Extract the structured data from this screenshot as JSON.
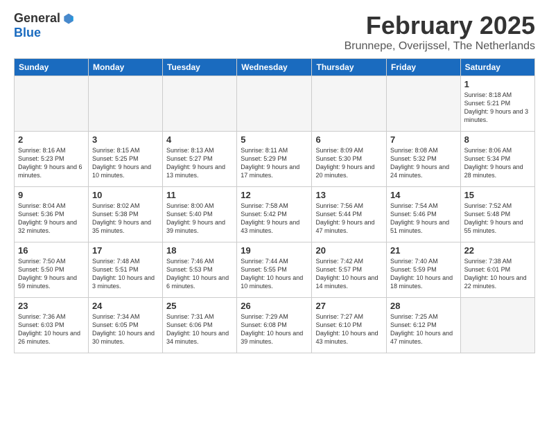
{
  "logo": {
    "general": "General",
    "blue": "Blue"
  },
  "title": "February 2025",
  "subtitle": "Brunnepe, Overijssel, The Netherlands",
  "days_header": [
    "Sunday",
    "Monday",
    "Tuesday",
    "Wednesday",
    "Thursday",
    "Friday",
    "Saturday"
  ],
  "weeks": [
    [
      {
        "day": "",
        "info": "",
        "empty": true
      },
      {
        "day": "",
        "info": "",
        "empty": true
      },
      {
        "day": "",
        "info": "",
        "empty": true
      },
      {
        "day": "",
        "info": "",
        "empty": true
      },
      {
        "day": "",
        "info": "",
        "empty": true
      },
      {
        "day": "",
        "info": "",
        "empty": true
      },
      {
        "day": "1",
        "info": "Sunrise: 8:18 AM\nSunset: 5:21 PM\nDaylight: 9 hours and 3 minutes."
      }
    ],
    [
      {
        "day": "2",
        "info": "Sunrise: 8:16 AM\nSunset: 5:23 PM\nDaylight: 9 hours and 6 minutes."
      },
      {
        "day": "3",
        "info": "Sunrise: 8:15 AM\nSunset: 5:25 PM\nDaylight: 9 hours and 10 minutes."
      },
      {
        "day": "4",
        "info": "Sunrise: 8:13 AM\nSunset: 5:27 PM\nDaylight: 9 hours and 13 minutes."
      },
      {
        "day": "5",
        "info": "Sunrise: 8:11 AM\nSunset: 5:29 PM\nDaylight: 9 hours and 17 minutes."
      },
      {
        "day": "6",
        "info": "Sunrise: 8:09 AM\nSunset: 5:30 PM\nDaylight: 9 hours and 20 minutes."
      },
      {
        "day": "7",
        "info": "Sunrise: 8:08 AM\nSunset: 5:32 PM\nDaylight: 9 hours and 24 minutes."
      },
      {
        "day": "8",
        "info": "Sunrise: 8:06 AM\nSunset: 5:34 PM\nDaylight: 9 hours and 28 minutes."
      }
    ],
    [
      {
        "day": "9",
        "info": "Sunrise: 8:04 AM\nSunset: 5:36 PM\nDaylight: 9 hours and 32 minutes."
      },
      {
        "day": "10",
        "info": "Sunrise: 8:02 AM\nSunset: 5:38 PM\nDaylight: 9 hours and 35 minutes."
      },
      {
        "day": "11",
        "info": "Sunrise: 8:00 AM\nSunset: 5:40 PM\nDaylight: 9 hours and 39 minutes."
      },
      {
        "day": "12",
        "info": "Sunrise: 7:58 AM\nSunset: 5:42 PM\nDaylight: 9 hours and 43 minutes."
      },
      {
        "day": "13",
        "info": "Sunrise: 7:56 AM\nSunset: 5:44 PM\nDaylight: 9 hours and 47 minutes."
      },
      {
        "day": "14",
        "info": "Sunrise: 7:54 AM\nSunset: 5:46 PM\nDaylight: 9 hours and 51 minutes."
      },
      {
        "day": "15",
        "info": "Sunrise: 7:52 AM\nSunset: 5:48 PM\nDaylight: 9 hours and 55 minutes."
      }
    ],
    [
      {
        "day": "16",
        "info": "Sunrise: 7:50 AM\nSunset: 5:50 PM\nDaylight: 9 hours and 59 minutes."
      },
      {
        "day": "17",
        "info": "Sunrise: 7:48 AM\nSunset: 5:51 PM\nDaylight: 10 hours and 3 minutes."
      },
      {
        "day": "18",
        "info": "Sunrise: 7:46 AM\nSunset: 5:53 PM\nDaylight: 10 hours and 6 minutes."
      },
      {
        "day": "19",
        "info": "Sunrise: 7:44 AM\nSunset: 5:55 PM\nDaylight: 10 hours and 10 minutes."
      },
      {
        "day": "20",
        "info": "Sunrise: 7:42 AM\nSunset: 5:57 PM\nDaylight: 10 hours and 14 minutes."
      },
      {
        "day": "21",
        "info": "Sunrise: 7:40 AM\nSunset: 5:59 PM\nDaylight: 10 hours and 18 minutes."
      },
      {
        "day": "22",
        "info": "Sunrise: 7:38 AM\nSunset: 6:01 PM\nDaylight: 10 hours and 22 minutes."
      }
    ],
    [
      {
        "day": "23",
        "info": "Sunrise: 7:36 AM\nSunset: 6:03 PM\nDaylight: 10 hours and 26 minutes."
      },
      {
        "day": "24",
        "info": "Sunrise: 7:34 AM\nSunset: 6:05 PM\nDaylight: 10 hours and 30 minutes."
      },
      {
        "day": "25",
        "info": "Sunrise: 7:31 AM\nSunset: 6:06 PM\nDaylight: 10 hours and 34 minutes."
      },
      {
        "day": "26",
        "info": "Sunrise: 7:29 AM\nSunset: 6:08 PM\nDaylight: 10 hours and 39 minutes."
      },
      {
        "day": "27",
        "info": "Sunrise: 7:27 AM\nSunset: 6:10 PM\nDaylight: 10 hours and 43 minutes."
      },
      {
        "day": "28",
        "info": "Sunrise: 7:25 AM\nSunset: 6:12 PM\nDaylight: 10 hours and 47 minutes."
      },
      {
        "day": "",
        "info": "",
        "empty": true
      }
    ]
  ]
}
